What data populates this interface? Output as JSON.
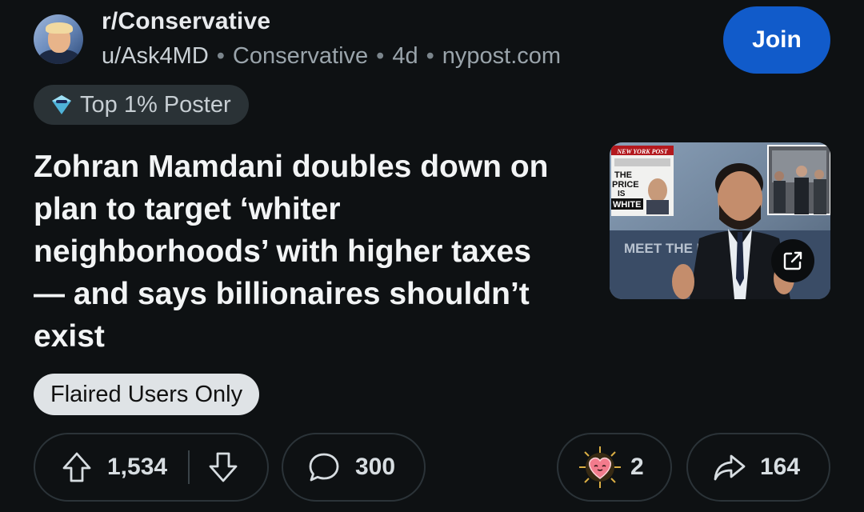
{
  "post": {
    "subreddit": "r/Conservative",
    "author": "u/Ask4MD",
    "flair_community": "Conservative",
    "age": "4d",
    "domain": "nypost.com",
    "join_label": "Join",
    "badge_label": "Top 1% Poster",
    "title": "Zohran Mamdani doubles down on plan to target ‘whiter neighborhoods’ with higher taxes — and says billionaires shouldn’t exist",
    "flair": "Flaired Users Only"
  },
  "thumbnail": {
    "newspaper_masthead": "NEW YORK POST",
    "headline_line1": "THE",
    "headline_line2": "PRICE",
    "headline_line3": "IS",
    "headline_line4": "WHITE",
    "backdrop_text": "MEET THE PR"
  },
  "actions": {
    "upvotes": "1,534",
    "comments": "300",
    "awards": "2",
    "shares": "164"
  },
  "colors": {
    "background": "#0e1113",
    "join": "#115bca",
    "pill_border": "#2b3338",
    "flair_bg": "#dfe3e6"
  },
  "icons": [
    "upvote-icon",
    "downvote-icon",
    "comment-icon",
    "award-icon",
    "share-icon",
    "external-link-icon",
    "badge-icon"
  ]
}
